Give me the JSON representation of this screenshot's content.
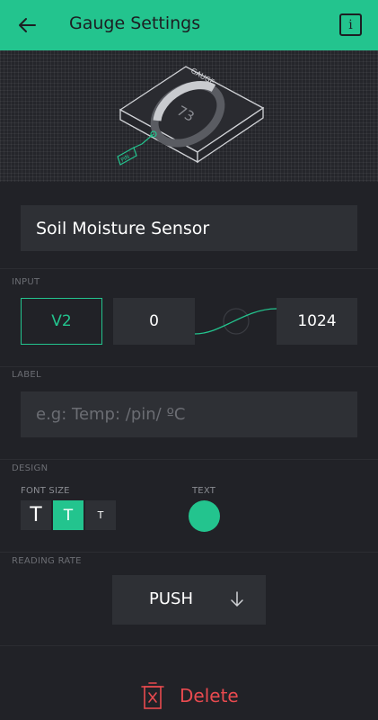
{
  "header": {
    "title": "Gauge Settings",
    "back_icon": "arrow-left-icon",
    "info_icon": "info-icon",
    "info_label": "i",
    "background": "#23c48e"
  },
  "hero": {
    "widget_label": "GAUGE",
    "gauge_value": "73",
    "pin_label": "PIN"
  },
  "name": {
    "value": "Soil Moisture Sensor"
  },
  "input": {
    "section_label": "INPUT",
    "pin": "V2",
    "min": "0",
    "max": "1024"
  },
  "label": {
    "section_label": "LABEL",
    "placeholder": "e.g: Temp: /pin/ ºC"
  },
  "design": {
    "section_label": "DESIGN",
    "font_size_label": "FONT SIZE",
    "font_sizes": [
      "T",
      "T",
      "T"
    ],
    "selected_font_size_index": 1,
    "text_color_label": "TEXT",
    "text_color": "#23c48e"
  },
  "reading_rate": {
    "section_label": "READING RATE",
    "value": "PUSH",
    "arrow_icon": "arrow-down-icon"
  },
  "delete": {
    "label": "Delete",
    "icon": "trash-icon",
    "color": "#e84a4f"
  },
  "colors": {
    "accent": "#23c48e",
    "background": "#212227",
    "field": "#2e3035",
    "muted_text": "#6b6d73",
    "danger": "#e84a4f"
  }
}
